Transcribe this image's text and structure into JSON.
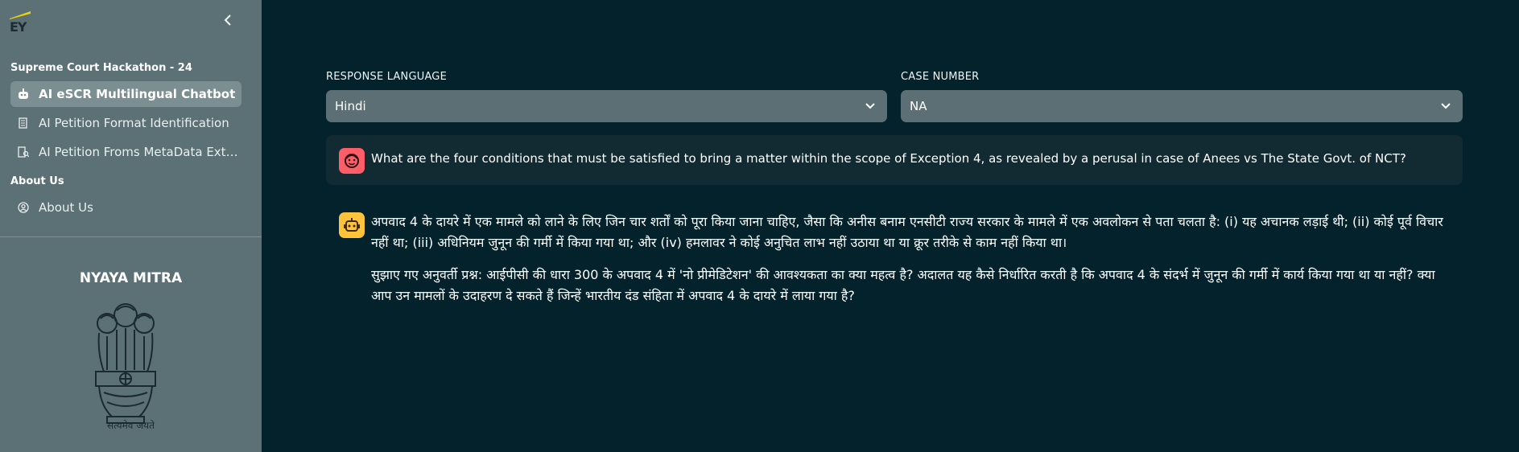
{
  "sidebar": {
    "logo_text": "EY",
    "collapse_icon": "chevron-left-icon",
    "section1_title": "Supreme Court Hackathon - 24",
    "items": [
      {
        "label": "AI eSCR Multilingual Chatbot",
        "icon": "chatbot-icon",
        "active": true
      },
      {
        "label": "AI Petition Format Identification",
        "icon": "document-icon",
        "active": false
      },
      {
        "label": "AI Petition Froms MetaData Extraction",
        "icon": "document-search-icon",
        "active": false
      }
    ],
    "section2_title": "About Us",
    "about_item": {
      "label": "About Us",
      "icon": "user-circle-icon"
    },
    "brand_title": "NYAYA MITRA",
    "motto": "सत्यमेव जयते"
  },
  "form": {
    "language_label": "RESPONSE LANGUAGE",
    "language_value": "Hindi",
    "case_label": "CASE NUMBER",
    "case_value": "NA"
  },
  "chat": {
    "question": "What are the four conditions that must be satisfied to bring a matter within the scope of Exception 4, as revealed by a perusal in case of Anees vs The State Govt. of NCT?",
    "answer_p1": "अपवाद 4 के दायरे में एक मामले को लाने के लिए जिन चार शर्तों को पूरा किया जाना चाहिए, जैसा कि अनीस बनाम एनसीटी राज्य सरकार के मामले में एक अवलोकन से पता चलता है: (i) यह अचानक लड़ाई थी; (ii) कोई पूर्व विचार नहीं था; (iii) अधिनियम जुनून की गर्मी में किया गया था; और (iv) हमलावर ने कोई अनुचित लाभ नहीं उठाया था या क्रूर तरीके से काम नहीं किया था।",
    "answer_p2": "सुझाए गए अनुवर्ती प्रश्न: आईपीसी की धारा 300 के अपवाद 4 में 'नो प्रीमेडिटेशन' की आवश्यकता का क्या महत्व है? अदालत यह कैसे निर्धारित करती है कि अपवाद 4 के संदर्भ में जुनून की गर्मी में कार्य किया गया था या नहीं? क्या आप उन मामलों के उदाहरण दे सकते हैं जिन्हें भारतीय दंड संहिता में अपवाद 4 के दायरे में लाया गया है?"
  },
  "colors": {
    "main_bg": "#03222b",
    "sidebar_bg": "#5c7176",
    "user_avatar": "#ff5d67",
    "bot_avatar": "#ffc23b"
  }
}
